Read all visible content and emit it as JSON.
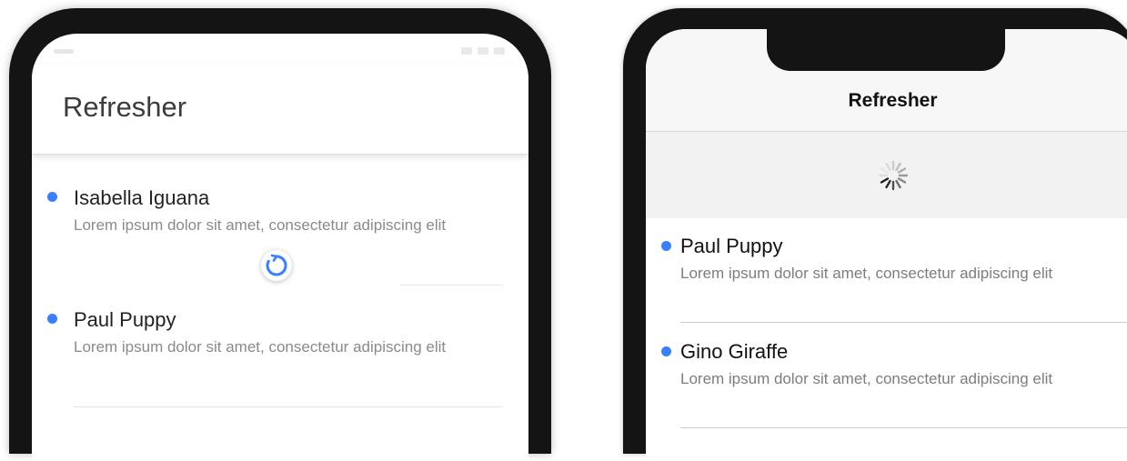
{
  "colors": {
    "accent": "#3880ff",
    "frame": "#141414",
    "ios_header_bg": "#f7f7f7",
    "ios_refresher_bg": "#f2f2f2"
  },
  "left_phone": {
    "platform": "md",
    "title": "Refresher",
    "spinner_icon": "circular-refresh-icon",
    "items": [
      {
        "name": "Isabella Iguana",
        "description": "Lorem ipsum dolor sit amet, consectetur adipiscing elit"
      },
      {
        "name": "Paul Puppy",
        "description": "Lorem ipsum dolor sit amet, consectetur adipiscing elit"
      }
    ]
  },
  "right_phone": {
    "platform": "ios",
    "title": "Refresher",
    "spinner_icon": "lines-spinner-icon",
    "items": [
      {
        "name": "Paul Puppy",
        "description": "Lorem ipsum dolor sit amet, consectetur adipiscing elit"
      },
      {
        "name": "Gino Giraffe",
        "description": "Lorem ipsum dolor sit amet, consectetur adipiscing elit"
      }
    ]
  }
}
